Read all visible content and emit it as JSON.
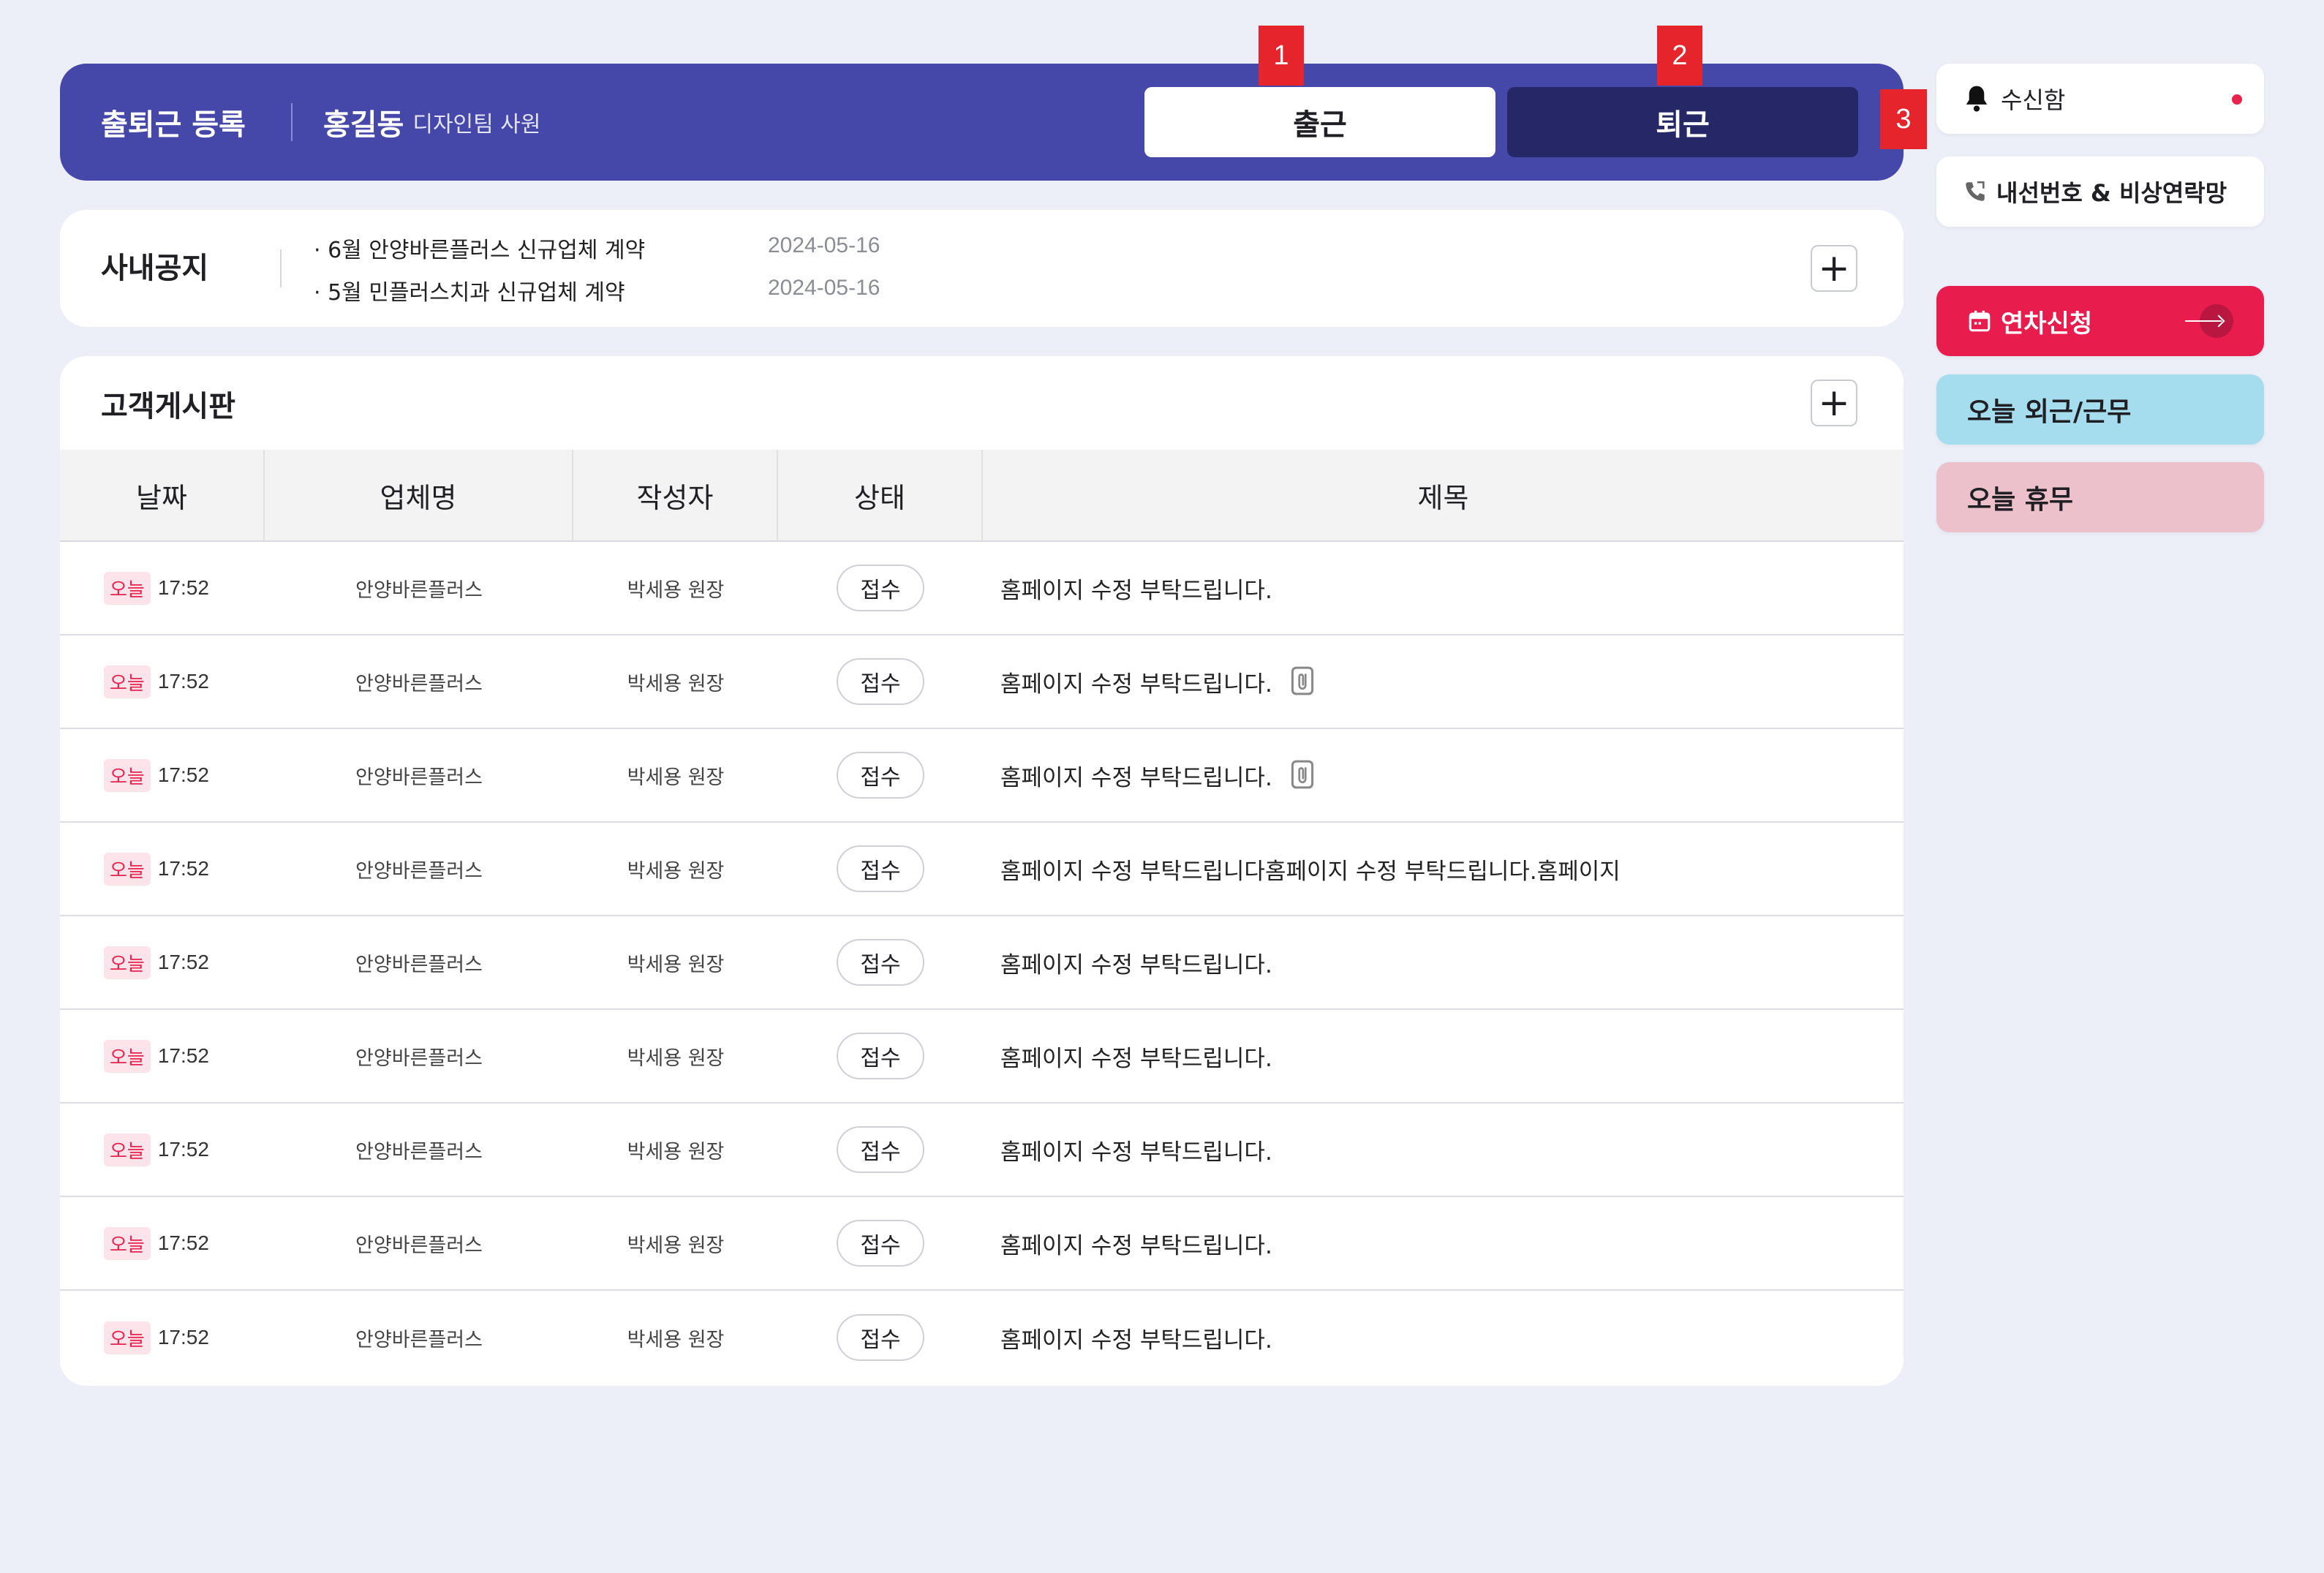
{
  "attendance": {
    "title": "출퇴근 등록",
    "user_name": "홍길동",
    "user_dept": "디자인팀 사원",
    "clock_in_label": "출근",
    "clock_out_label": "퇴근"
  },
  "markers": [
    "1",
    "2",
    "3"
  ],
  "notice": {
    "title": "사내공지",
    "items": [
      {
        "text": "· 6월 안양바른플러스 신규업체 계약",
        "date": "2024-05-16"
      },
      {
        "text": "· 5월 민플러스치과 신규업체 계약",
        "date": "2024-05-16"
      }
    ],
    "more_icon": "plus-icon"
  },
  "board": {
    "title": "고객게시판",
    "more_icon": "plus-icon",
    "columns": [
      "날짜",
      "업체명",
      "작성자",
      "상태",
      "제목"
    ],
    "rows": [
      {
        "badge": "오늘",
        "time": "17:52",
        "company": "안양바른플러스",
        "writer": "박세용 원장",
        "status": "접수",
        "subject": "홈페이지 수정 부탁드립니다.",
        "attachment": false
      },
      {
        "badge": "오늘",
        "time": "17:52",
        "company": "안양바른플러스",
        "writer": "박세용 원장",
        "status": "접수",
        "subject": "홈페이지 수정 부탁드립니다.",
        "attachment": true
      },
      {
        "badge": "오늘",
        "time": "17:52",
        "company": "안양바른플러스",
        "writer": "박세용 원장",
        "status": "접수",
        "subject": "홈페이지 수정 부탁드립니다.",
        "attachment": true
      },
      {
        "badge": "오늘",
        "time": "17:52",
        "company": "안양바른플러스",
        "writer": "박세용 원장",
        "status": "접수",
        "subject": "홈페이지 수정 부탁드립니다홈페이지 수정 부탁드립니다.홈페이지",
        "attachment": false
      },
      {
        "badge": "오늘",
        "time": "17:52",
        "company": "안양바른플러스",
        "writer": "박세용 원장",
        "status": "접수",
        "subject": "홈페이지 수정 부탁드립니다.",
        "attachment": false
      },
      {
        "badge": "오늘",
        "time": "17:52",
        "company": "안양바른플러스",
        "writer": "박세용 원장",
        "status": "접수",
        "subject": "홈페이지 수정 부탁드립니다.",
        "attachment": false
      },
      {
        "badge": "오늘",
        "time": "17:52",
        "company": "안양바른플러스",
        "writer": "박세용 원장",
        "status": "접수",
        "subject": "홈페이지 수정 부탁드립니다.",
        "attachment": false
      },
      {
        "badge": "오늘",
        "time": "17:52",
        "company": "안양바른플러스",
        "writer": "박세용 원장",
        "status": "접수",
        "subject": "홈페이지 수정 부탁드립니다.",
        "attachment": false
      },
      {
        "badge": "오늘",
        "time": "17:52",
        "company": "안양바른플러스",
        "writer": "박세용 원장",
        "status": "접수",
        "subject": "홈페이지 수정 부탁드립니다.",
        "attachment": false
      }
    ]
  },
  "sidebar": {
    "inbox_label": "수신함",
    "contacts_label": "내선번호 & 비상연락망",
    "leave_label": "연차신청",
    "outwork_label": "오늘 외근/근무",
    "dayoff_label": "오늘 휴무"
  },
  "colors": {
    "attendance_bar": "#4547a9",
    "clock_out_button": "#262767",
    "leave_button": "#e91c4e",
    "outwork_button": "#a5dcee",
    "dayoff_button": "#ecc1cc",
    "today_badge_text": "#e8224f",
    "marker": "#e5242b"
  }
}
